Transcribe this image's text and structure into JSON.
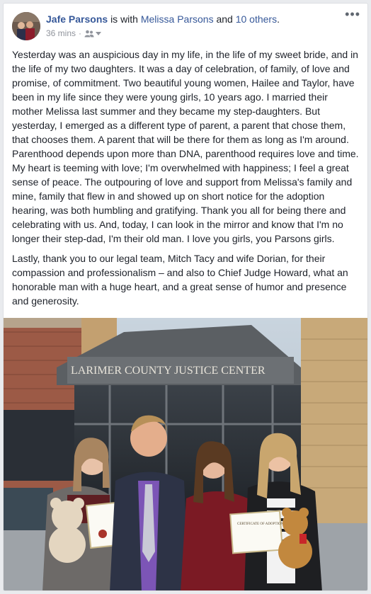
{
  "post": {
    "author": "Jafe Parsons",
    "with_text": "is with",
    "tagged": "Melissa Parsons",
    "and_text": "and",
    "others": "10 others",
    "period": ".",
    "time": "36 mins",
    "dot": "·",
    "audience_icon": "friends-icon",
    "paragraphs": [
      "Yesterday was an auspicious day in my life, in the life of my sweet bride, and in the life of my two daughters. It was a day of celebration, of family, of love and promise, of commitment. Two beautiful young women, Hailee and Taylor, have been in my life since they were young girls, 10 years ago. I married their mother Melissa last summer and they became my step-daughters. But yesterday, I emerged as a different type of parent, a parent that chose them, that chooses them. A parent that will be there for them as long as I'm around. Parenthood depends upon more than DNA, parenthood requires love and time. My heart is teeming with love; I'm overwhelmed with happiness; I feel a great sense of peace. The outpouring of love and support from Melissa's family and mine, family that flew in and showed up on short notice for the adoption hearing, was both humbling and gratifying. Thank you all for being there and celebrating with us. And, today, I can look in the mirror and know that I'm no longer their step-dad, I'm their old man. I love you girls, you Parsons girls.",
      "Lastly, thank you to our legal team, Mitch Tacy and wife Dorian, for their compassion and professionalism – and also to Chief Judge Howard, what an honorable man with a huge heart, and a great sense of humor and presence and generosity."
    ],
    "photo": {
      "building_sign": "LARIMER COUNTY JUSTICE CENTER",
      "certificate_title": "CERTIFICATE OF ADOPTION"
    }
  },
  "colors": {
    "link": "#365899",
    "text": "#1d2129",
    "meta": "#90949c",
    "bg": "#e9ebee"
  }
}
